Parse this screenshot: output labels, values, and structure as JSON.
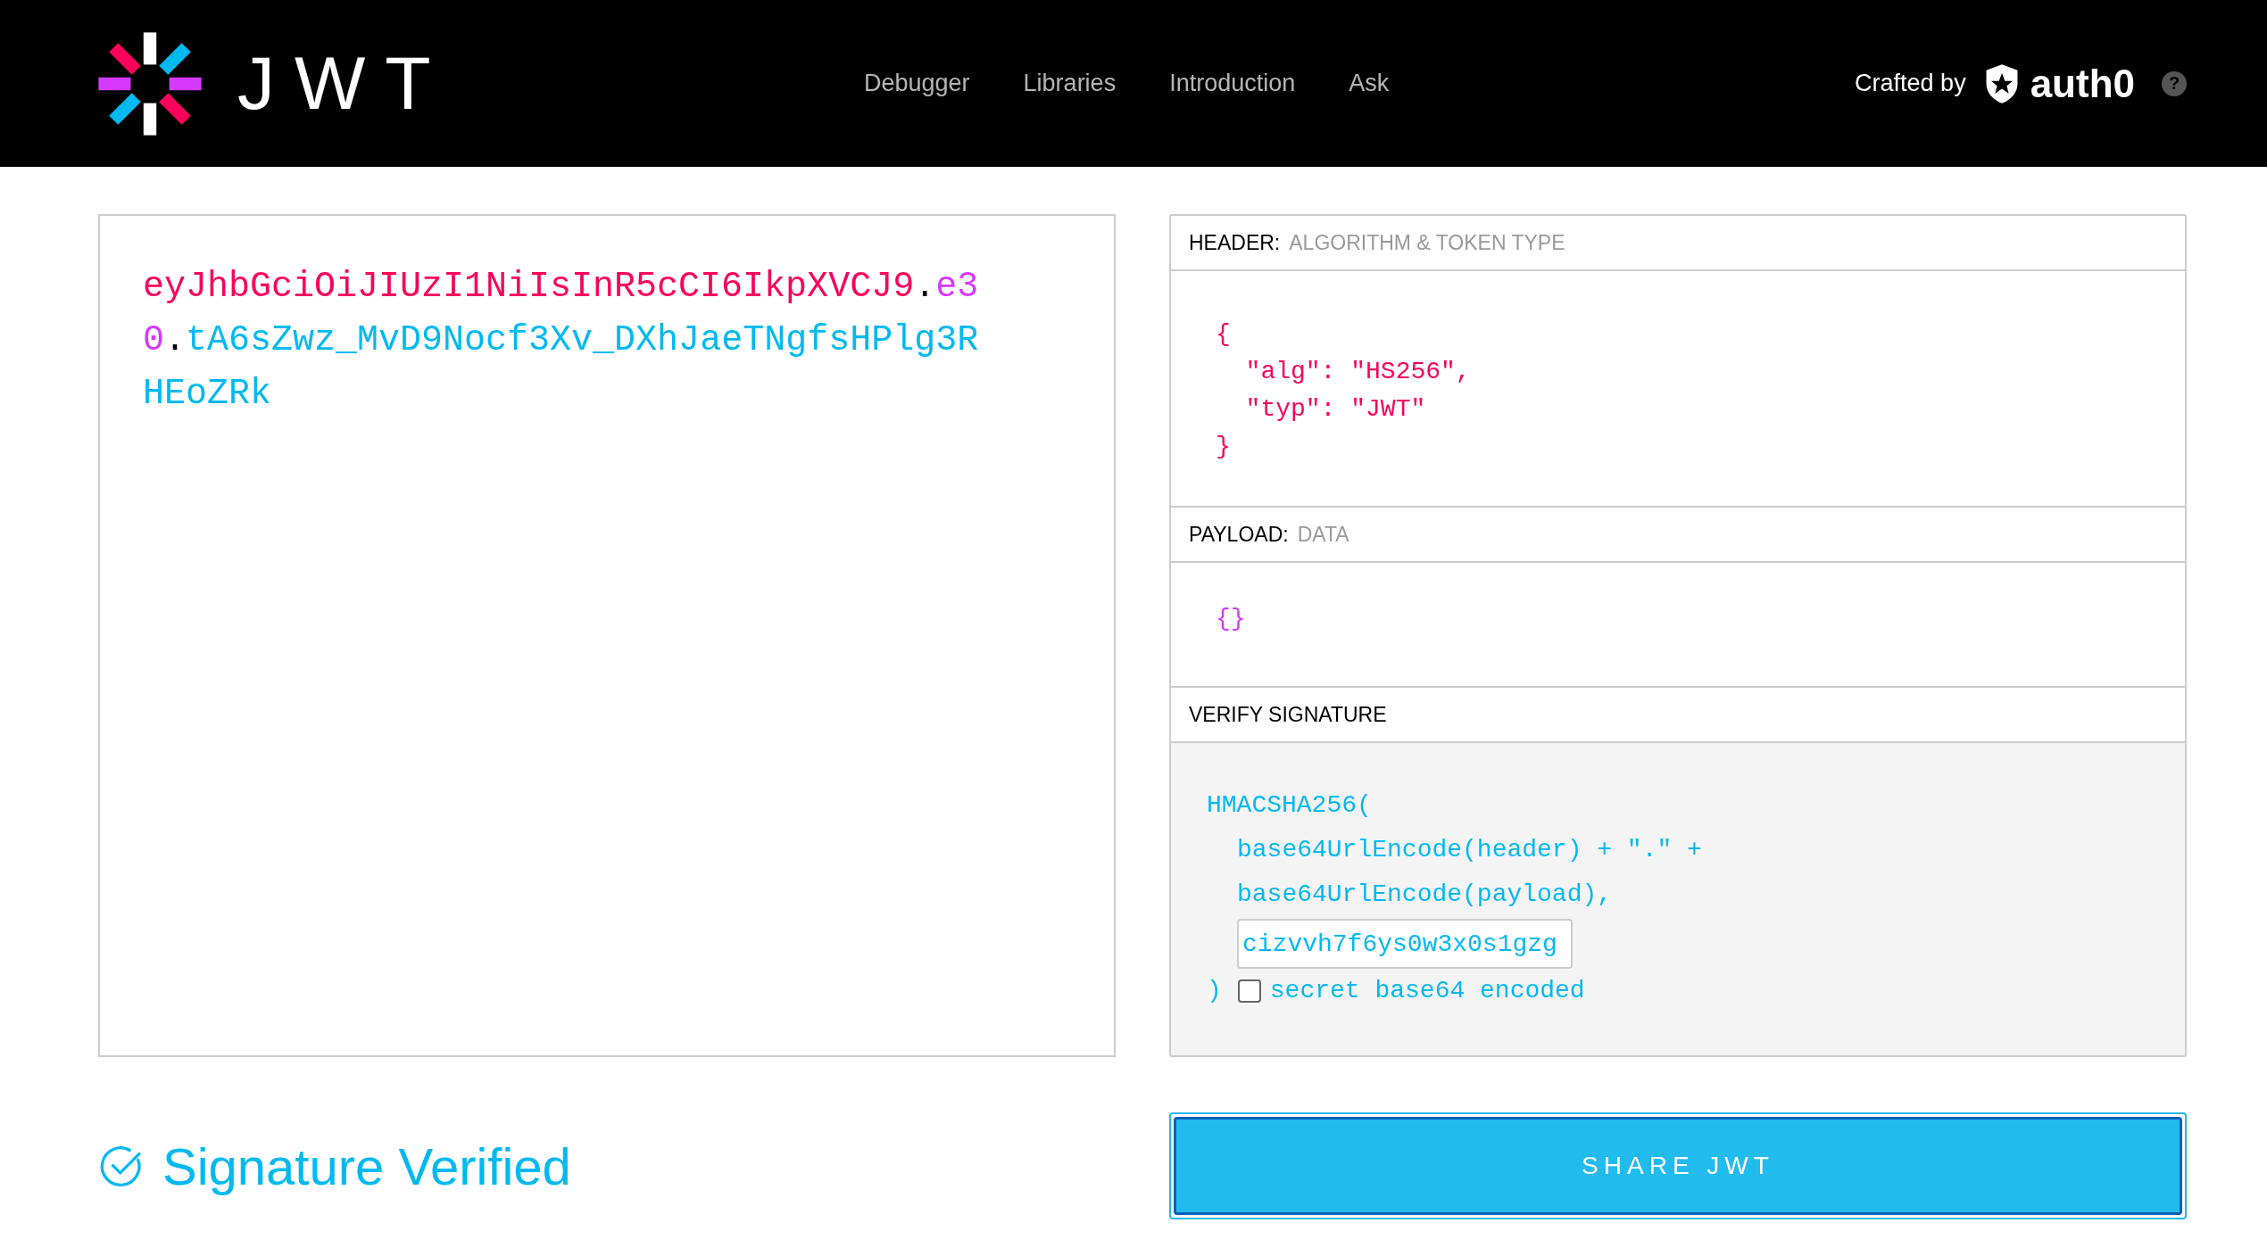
{
  "nav": {
    "logo_text": "JWT",
    "links": [
      {
        "label": "Debugger",
        "selected": false
      },
      {
        "label": "Libraries",
        "selected": false
      },
      {
        "label": "Introduction",
        "selected": false
      },
      {
        "label": "Ask",
        "selected": false
      }
    ],
    "crafted_by": "Crafted by",
    "brand": "auth0",
    "help": "?"
  },
  "encoded": {
    "segments": [
      {
        "kind": "header",
        "text": "eyJhbGciOiJIUzI1NiIsInR5cCI6IkpXVCJ9"
      },
      {
        "kind": "dot",
        "text": "."
      },
      {
        "kind": "payload",
        "text": "e30"
      },
      {
        "kind": "dot",
        "text": "."
      },
      {
        "kind": "signature",
        "text": "tA6sZwz_MvD9Nocf3Xv_DXhJaeTNgfsHPlg3RHEoZRk"
      }
    ]
  },
  "header": {
    "title": "HEADER:",
    "subtitle": "ALGORITHM & TOKEN TYPE",
    "code": "{\n  \"alg\": \"HS256\",\n  \"typ\": \"JWT\"\n}"
  },
  "payload": {
    "title": "PAYLOAD:",
    "subtitle": "DATA",
    "code": "{}"
  },
  "verify": {
    "title": "VERIFY SIGNATURE",
    "lines": [
      "HMACSHA256(",
      "base64UrlEncode(header) + \".\" +",
      "base64UrlEncode(payload),"
    ],
    "secret": "cizvvh7f6ys0w3x0s1gzg",
    "close": ")",
    "checkbox_label": "secret base64 encoded",
    "checked": false
  },
  "status": {
    "text": "Signature Verified",
    "verified": true
  },
  "share_button": "SHARE JWT"
}
